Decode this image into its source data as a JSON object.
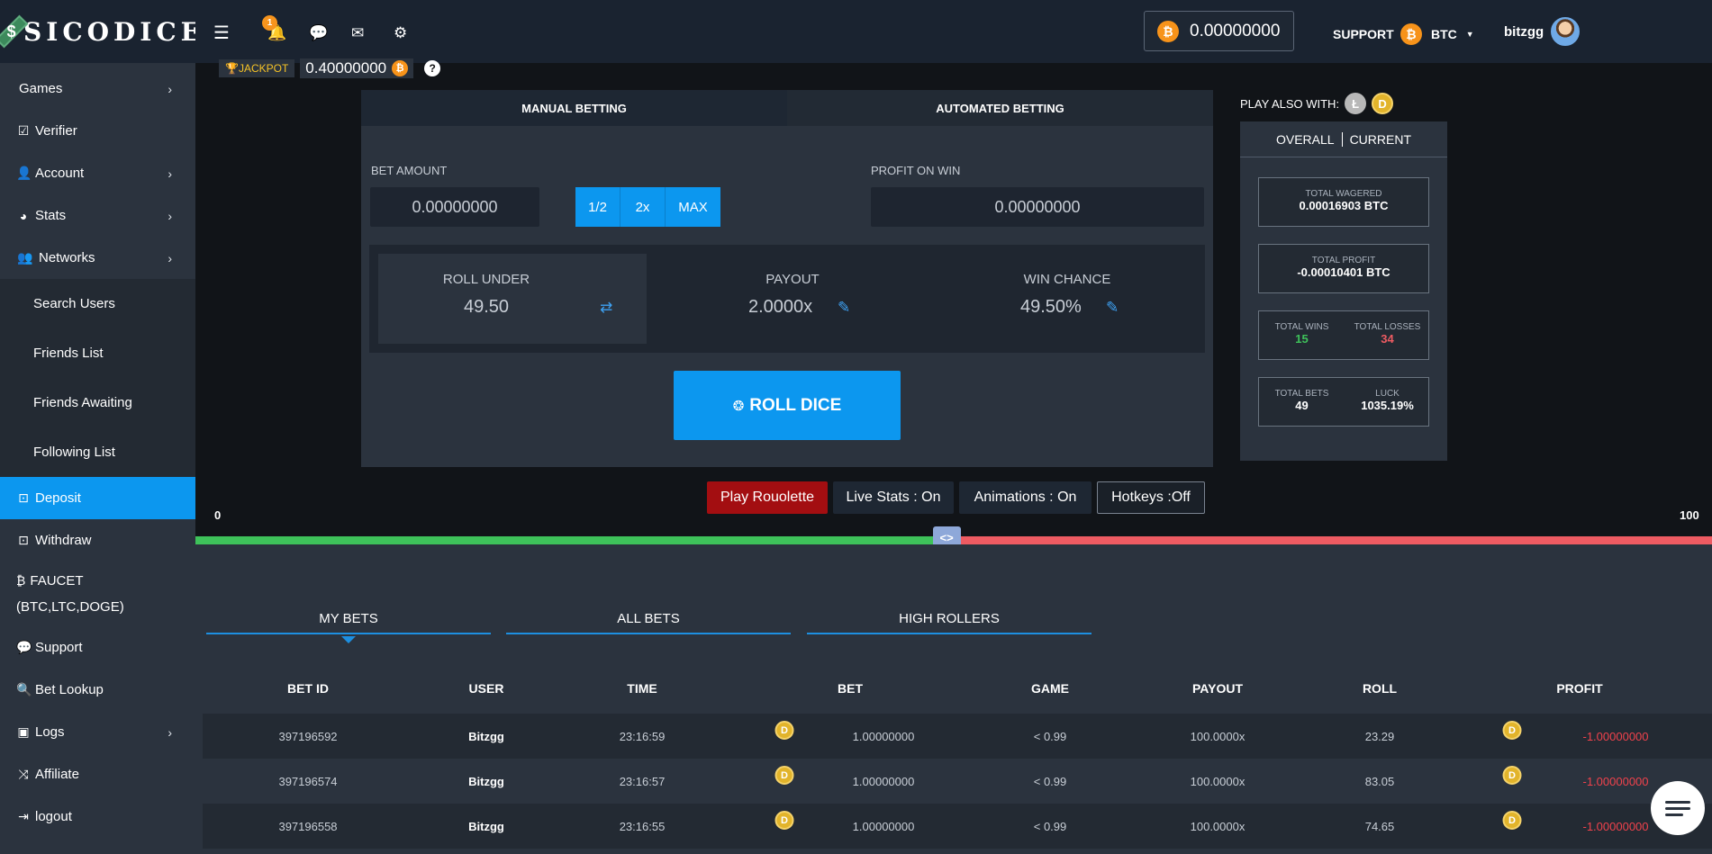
{
  "brand": {
    "logo_mark": "$",
    "name": "SICODICE"
  },
  "sidebar": {
    "items": [
      {
        "label": "Games",
        "icon": "chevron",
        "has_chevron": true
      },
      {
        "label": "Verifier",
        "icon": "check-square-icon"
      },
      {
        "label": "Account",
        "icon": "user-icon",
        "has_chevron": true
      },
      {
        "label": "Stats",
        "icon": "pie-chart-icon",
        "has_chevron": true
      },
      {
        "label": "Networks",
        "icon": "users-icon",
        "has_chevron": true
      }
    ],
    "sub_items": [
      "Search Users",
      "Friends List",
      "Friends Awaiting",
      "Following List"
    ],
    "lower_items": [
      {
        "label": "Deposit",
        "icon": "download-icon",
        "active": true
      },
      {
        "label": "Withdraw",
        "icon": "upload-icon"
      },
      {
        "label": "FAUCET (BTC,LTC,DOGE)",
        "icon": "bitcoin-icon"
      },
      {
        "label": "Support",
        "icon": "comments-icon"
      },
      {
        "label": "Bet Lookup",
        "icon": "search-icon"
      },
      {
        "label": "Logs",
        "icon": "log-icon",
        "has_chevron": true
      },
      {
        "label": "Affiliate",
        "icon": "shuffle-icon"
      },
      {
        "label": "logout",
        "icon": "logout-icon"
      }
    ]
  },
  "header": {
    "notification_count": "1",
    "balance": "0.00000000",
    "support_label": "SUPPORT",
    "currency": "BTC",
    "username": "bitzgg"
  },
  "jackpot": {
    "label": "JACKPOT",
    "amount": "0.40000000"
  },
  "betting": {
    "tabs": [
      "MANUAL BETTING",
      "AUTOMATED BETTING"
    ],
    "bet_amount_label": "BET AMOUNT",
    "bet_amount_value": "0.00000000",
    "multipliers": [
      "1/2",
      "2x",
      "MAX"
    ],
    "profit_label": "PROFIT ON WIN",
    "profit_value": "0.00000000",
    "roll_under_label": "ROLL UNDER",
    "roll_under_value": "49.50",
    "payout_label": "PAYOUT",
    "payout_value": "2.0000x",
    "win_chance_label": "WIN CHANCE",
    "win_chance_value": "49.50%",
    "roll_button": "ROLL DICE"
  },
  "play_also": {
    "label": "PLAY ALSO WITH:",
    "coins": [
      "Ł",
      "D"
    ]
  },
  "stats": {
    "tabs": [
      "OVERALL",
      "CURRENT"
    ],
    "total_wagered_label": "TOTAL WAGERED",
    "total_wagered": "0.00016903 BTC",
    "total_profit_label": "TOTAL PROFIT",
    "total_profit": "-0.00010401 BTC",
    "total_wins_label": "TOTAL WINS",
    "total_wins": "15",
    "total_losses_label": "TOTAL LOSSES",
    "total_losses": "34",
    "total_bets_label": "TOTAL BETS",
    "total_bets": "49",
    "luck_label": "LUCK",
    "luck": "1035.19%"
  },
  "toggles": {
    "rouelette": "Play Rouolette",
    "live_stats": "Live Stats : On",
    "animations": "Animations : On",
    "hotkeys": "Hotkeys :Off"
  },
  "slider": {
    "min": "0",
    "max": "100",
    "value": 49.5,
    "handle": "<>"
  },
  "bets": {
    "tabs": [
      "MY BETS",
      "ALL BETS",
      "HIGH ROLLERS"
    ],
    "columns": [
      "BET ID",
      "USER",
      "TIME",
      "BET",
      "GAME",
      "PAYOUT",
      "ROLL",
      "PROFIT"
    ],
    "rows": [
      {
        "id": "397196592",
        "user": "Bitzgg",
        "time": "23:16:59",
        "bet": "1.00000000",
        "game": "< 0.99",
        "payout": "100.0000x",
        "roll": "23.29",
        "profit": "-1.00000000"
      },
      {
        "id": "397196574",
        "user": "Bitzgg",
        "time": "23:16:57",
        "bet": "1.00000000",
        "game": "< 0.99",
        "payout": "100.0000x",
        "roll": "83.05",
        "profit": "-1.00000000"
      },
      {
        "id": "397196558",
        "user": "Bitzgg",
        "time": "23:16:55",
        "bet": "1.00000000",
        "game": "< 0.99",
        "payout": "100.0000x",
        "roll": "74.65",
        "profit": "-1.00000000"
      }
    ]
  },
  "colors": {
    "accent": "#0c97ef",
    "win": "#3ec25a",
    "loss": "#ee5b62",
    "roulette": "#a30e11"
  }
}
